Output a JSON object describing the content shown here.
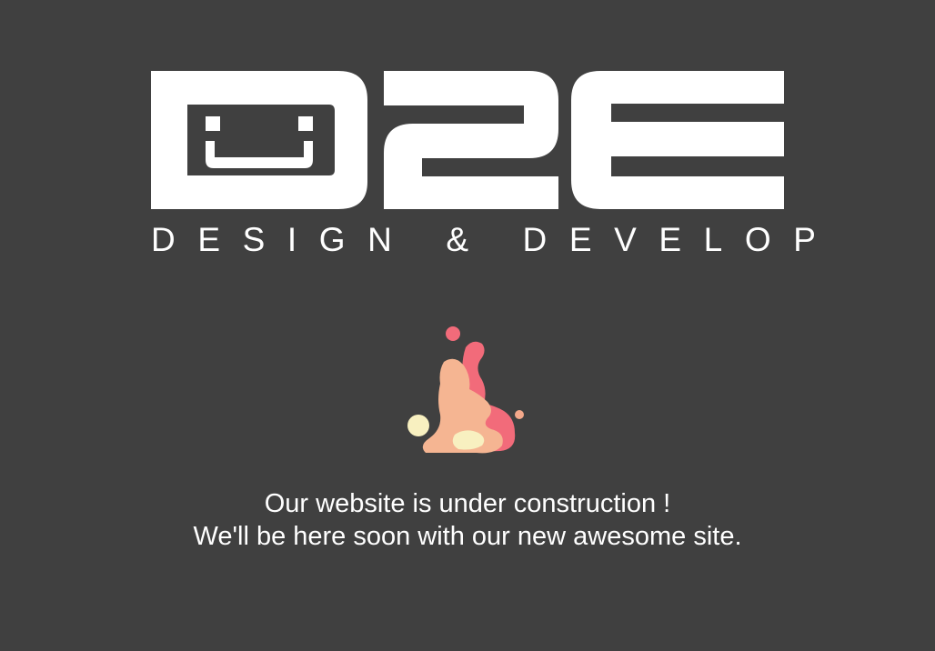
{
  "brand": {
    "logo_text": "D2E",
    "tagline": "DESIGN & DEVELOP"
  },
  "illustration": {
    "name": "paint-splash-icon",
    "colors": [
      "#f26b7a",
      "#f5b592",
      "#f8f0c0",
      "#f4a88a"
    ]
  },
  "message": {
    "line1": "Our website is under construction !",
    "line2": "We'll be here soon with our new awesome site."
  },
  "colors": {
    "background": "#404040",
    "foreground": "#ffffff"
  }
}
